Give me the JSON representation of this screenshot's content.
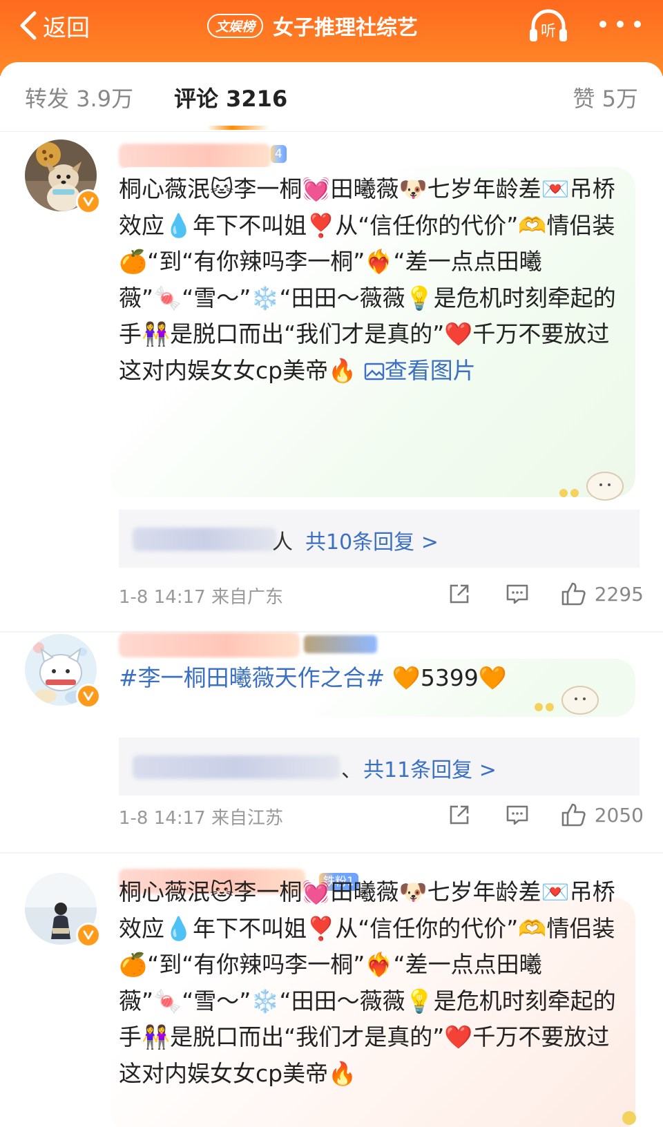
{
  "header": {
    "back_label": "返回",
    "tag_label": "文娱榜",
    "title": "女子推理社综艺",
    "listen_label": "听"
  },
  "tabs": {
    "repost": "转发 3.9万",
    "comment": "评论 3216",
    "like": "赞 5万"
  },
  "colors": {
    "header_orange": "#ff6a1e",
    "link_blue": "#3a6fc2",
    "verified_orange": "#ff9a1a"
  },
  "comments": [
    {
      "level_badge": "4",
      "text_parts": [
        "桐心薇泯",
        "🐱",
        "李一桐",
        "💓",
        "田曦薇",
        "🐶",
        "七岁年龄差",
        "💌",
        "吊桥效应",
        "💧",
        "年下不叫姐",
        "❣️",
        "从“信任你的代价”",
        "🫶",
        "情侣装",
        "🍊",
        "“到“有你辣吗李一桐”",
        "❤️‍🔥",
        "“差一点点田曦薇”",
        "🍬",
        "“雪～”",
        "❄️",
        "“田田～薇薇",
        "💡",
        "是危机时刻牵起的手",
        "👭",
        "是脱口而出“我们才是真的”",
        "❤️",
        "千万不要放过这对内娱女女cp美帝",
        "🔥"
      ],
      "view_image": "查看图片",
      "reply_suffix": "人",
      "reply_link": "共10条回复 >",
      "time": "1-8 14:17",
      "location": "来自广东",
      "likes": "2295",
      "icons": [
        "share-icon",
        "comment-icon",
        "thumbs-up-icon"
      ]
    },
    {
      "hashtag": "#李一桐田曦薇天作之合#",
      "emoji_a": "🧡",
      "number": "5399",
      "emoji_b": "🧡",
      "reply_suffix": "、",
      "reply_link": "共11条回复 >",
      "time": "1-8 14:17",
      "location": "来自江苏",
      "likes": "2050"
    },
    {
      "level_badge": "铁粉1",
      "text_parts": [
        "桐心薇泯",
        "🐱",
        "李一桐",
        "💓",
        "田曦薇",
        "🐶",
        "七岁年龄差",
        "💌",
        "吊桥效应",
        "💧",
        "年下不叫姐",
        "❣️",
        "从“信任你的代价”",
        "🫶",
        "情侣装",
        "🍊",
        "“到“有你辣吗李一桐”",
        "❤️‍🔥",
        "“差一点点田曦薇”",
        "🍬",
        "“雪～”",
        "❄️",
        "“田田～薇薇",
        "💡",
        "是危机时刻牵起的手",
        "👭",
        "是脱口而出“我们才是真的”",
        "❤️",
        "千万不要放过这对内娱女女cp美帝",
        "🔥"
      ]
    }
  ]
}
